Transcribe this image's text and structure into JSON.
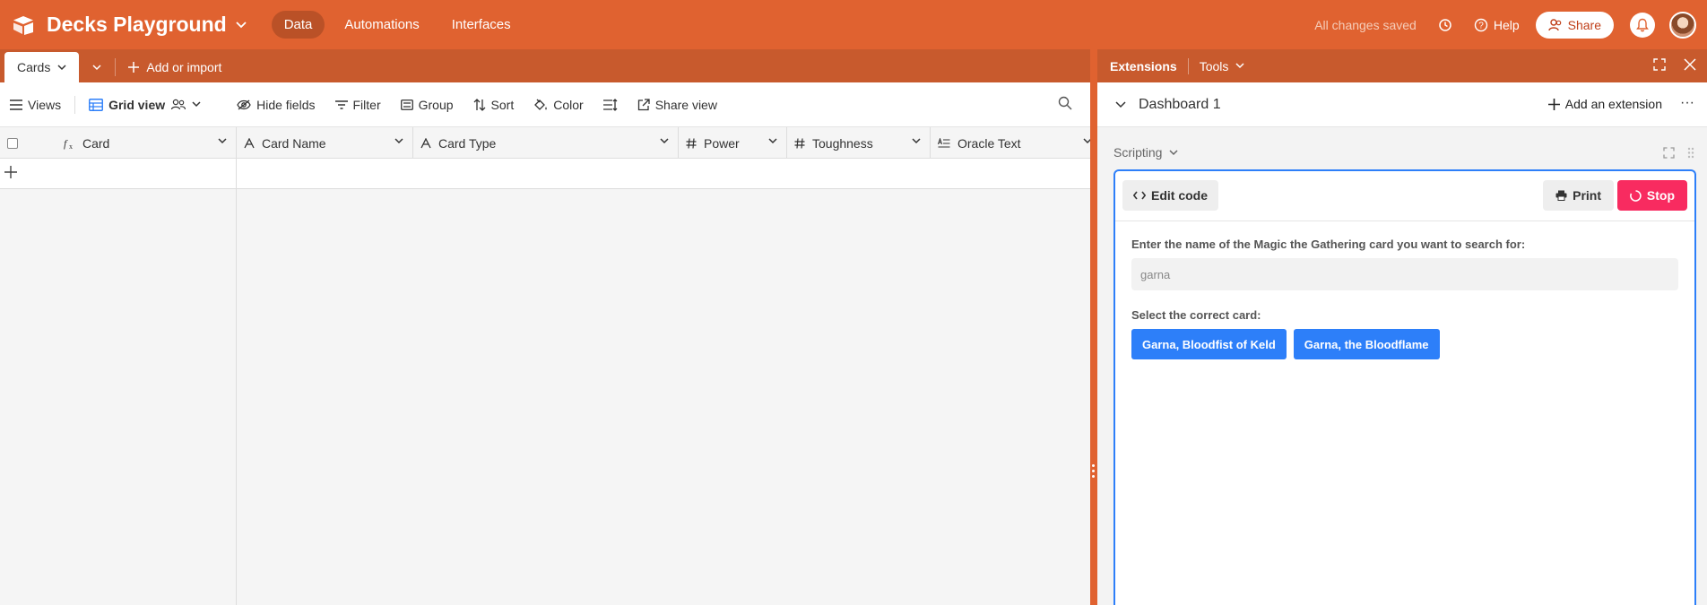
{
  "app": {
    "title": "Decks Playground"
  },
  "nav": [
    {
      "label": "Data",
      "active": true
    },
    {
      "label": "Automations",
      "active": false
    },
    {
      "label": "Interfaces",
      "active": false
    }
  ],
  "top_right": {
    "saved": "All changes saved",
    "help": "Help",
    "share": "Share"
  },
  "tabs": {
    "current": "Cards",
    "add_import": "Add or import"
  },
  "toolbar": {
    "views": "Views",
    "grid_view": "Grid view",
    "hide_fields": "Hide fields",
    "filter": "Filter",
    "group": "Group",
    "sort": "Sort",
    "color": "Color",
    "share_view": "Share view"
  },
  "columns": [
    {
      "name": "Card",
      "type": "formula-icon"
    },
    {
      "name": "Card Name",
      "type": "text-icon"
    },
    {
      "name": "Card Type",
      "type": "text-icon"
    },
    {
      "name": "Power",
      "type": "number-icon"
    },
    {
      "name": "Toughness",
      "type": "number-icon"
    },
    {
      "name": "Oracle Text",
      "type": "long-text-icon"
    }
  ],
  "extensions": {
    "title": "Extensions",
    "tools": "Tools",
    "dashboard": "Dashboard 1",
    "add_extension": "Add an extension",
    "script_label": "Scripting",
    "edit_code": "Edit code",
    "print": "Print",
    "stop": "Stop",
    "prompt": "Enter the name of the Magic the Gathering card you want to search for:",
    "input_value": "garna",
    "select_label": "Select the correct card:",
    "choices": [
      "Garna, Bloodfist of Keld",
      "Garna, the Bloodflame"
    ]
  },
  "colors": {
    "brand": "#e06230",
    "tab_bar": "#c85a2d",
    "accent_blue": "#2d7ff9",
    "stop_red": "#f82b60"
  }
}
